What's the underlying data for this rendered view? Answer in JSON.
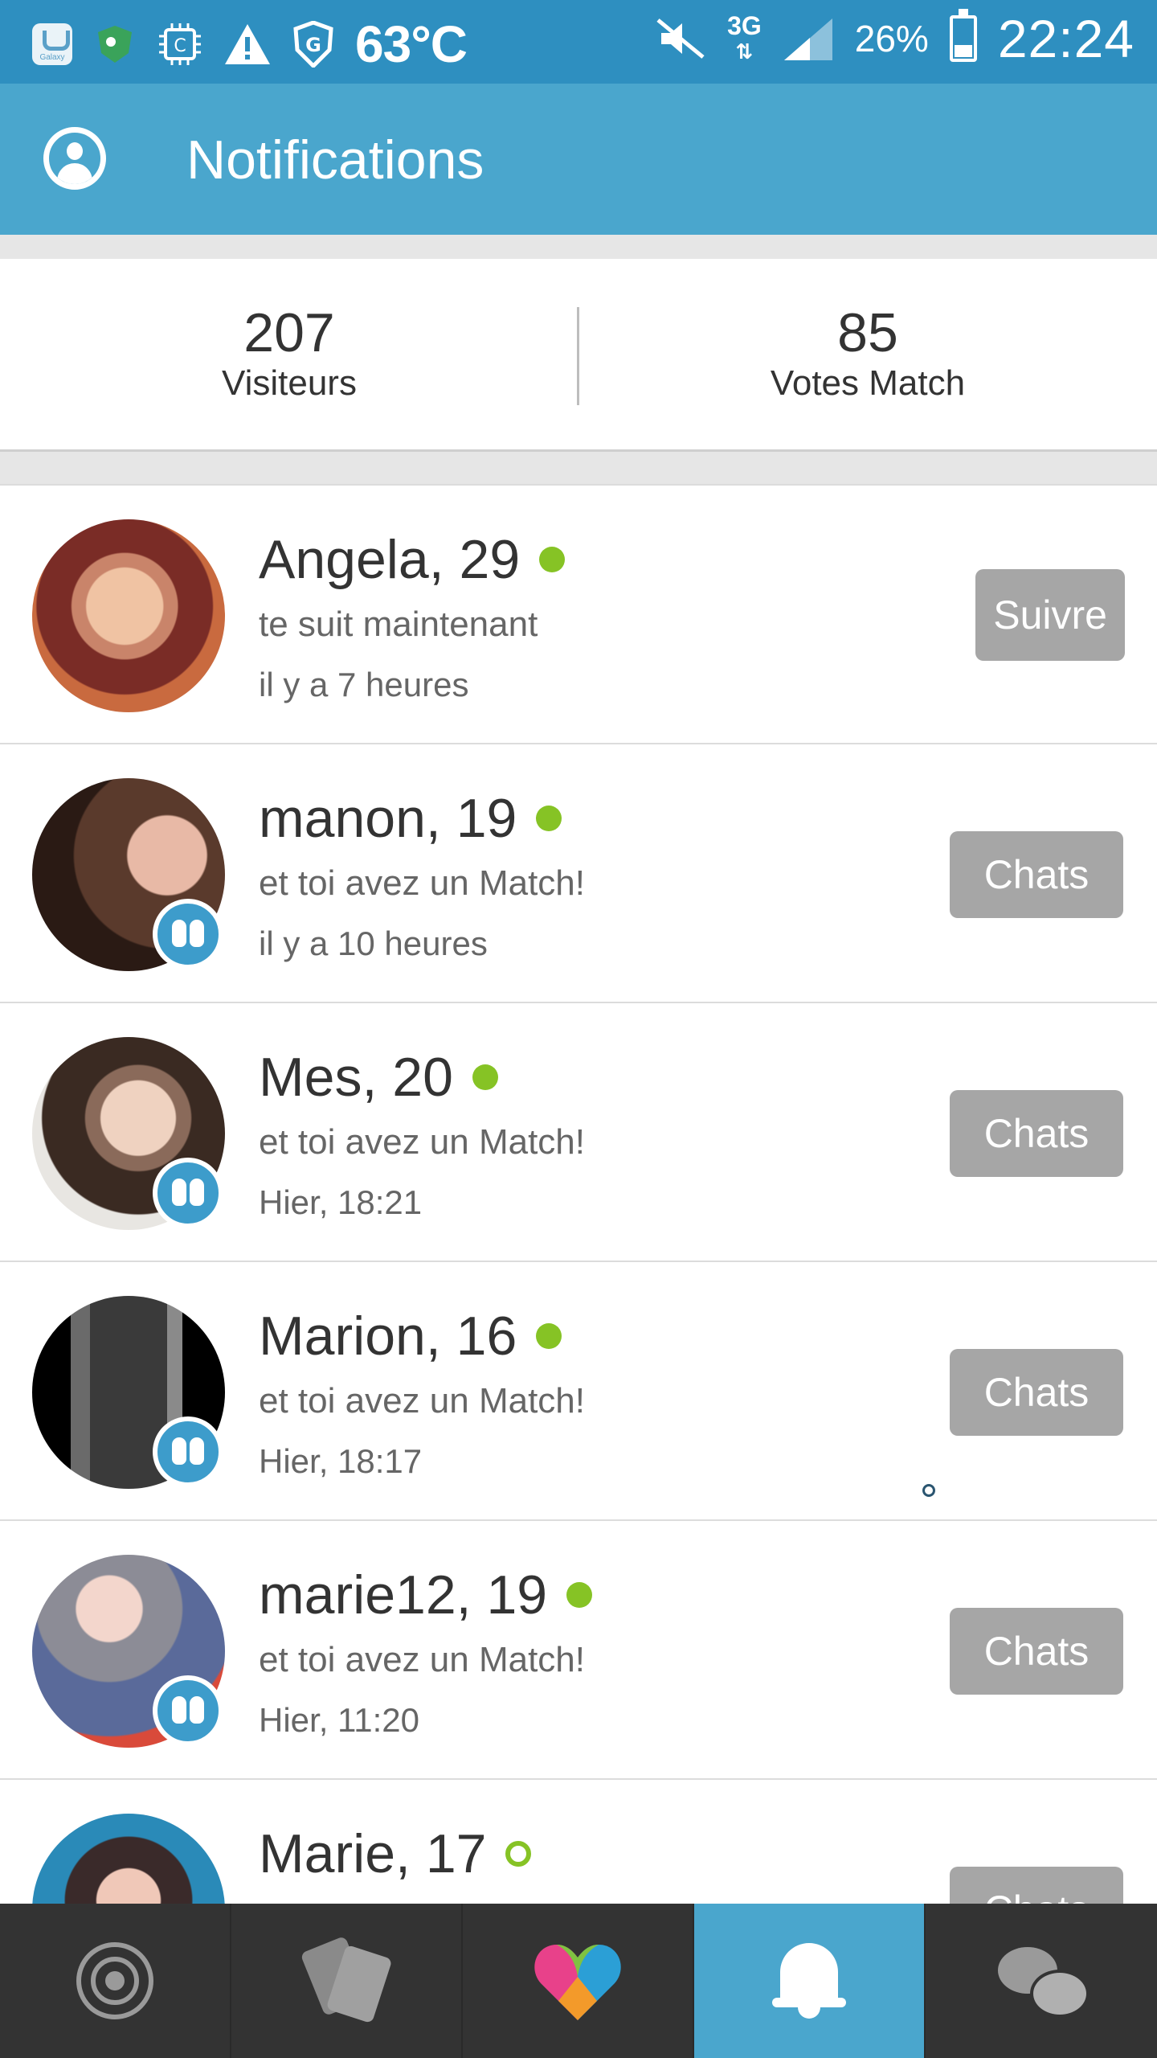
{
  "status_bar": {
    "temperature": "63°C",
    "network": "3G",
    "battery_percent": "26%",
    "time": "22:24",
    "galaxy_label": "Galaxy"
  },
  "app_bar": {
    "title": "Notifications"
  },
  "stats": {
    "visitors_value": "207",
    "visitors_label": "Visiteurs",
    "votes_value": "85",
    "votes_label": "Votes Match"
  },
  "notifications": [
    {
      "name": "Angela, 29",
      "subtitle": "te suit maintenant",
      "time": "il y a 7 heures",
      "action": "Suivre",
      "online": true,
      "match_badge": false
    },
    {
      "name": "manon, 19",
      "subtitle": "et toi avez un Match!",
      "time": "il y a 10 heures",
      "action": "Chats",
      "online": true,
      "match_badge": true
    },
    {
      "name": "Mes, 20",
      "subtitle": "et toi avez un Match!",
      "time": "Hier, 18:21",
      "action": "Chats",
      "online": true,
      "match_badge": true
    },
    {
      "name": "Marion, 16",
      "subtitle": "et toi avez un Match!",
      "time": "Hier, 18:17",
      "action": "Chats",
      "online": true,
      "match_badge": true
    },
    {
      "name": "marie12, 19",
      "subtitle": "et toi avez un Match!",
      "time": "Hier, 11:20",
      "action": "Chats",
      "online": true,
      "match_badge": true
    },
    {
      "name": "Marie, 17",
      "subtitle": "",
      "time": "",
      "action": "Chats",
      "online": false,
      "match_badge": false
    }
  ],
  "bottom_nav": [
    {
      "icon": "radar-icon",
      "active": false
    },
    {
      "icon": "cards-icon",
      "active": false
    },
    {
      "icon": "heart-match-icon",
      "active": false
    },
    {
      "icon": "bell-icon",
      "active": true
    },
    {
      "icon": "chat-bubbles-icon",
      "active": false
    }
  ],
  "colors": {
    "accent": "#4aa6cd",
    "status_bar": "#2e8fc0",
    "online": "#86c325",
    "button": "#a6a6a6",
    "nav_bg": "#333333"
  }
}
